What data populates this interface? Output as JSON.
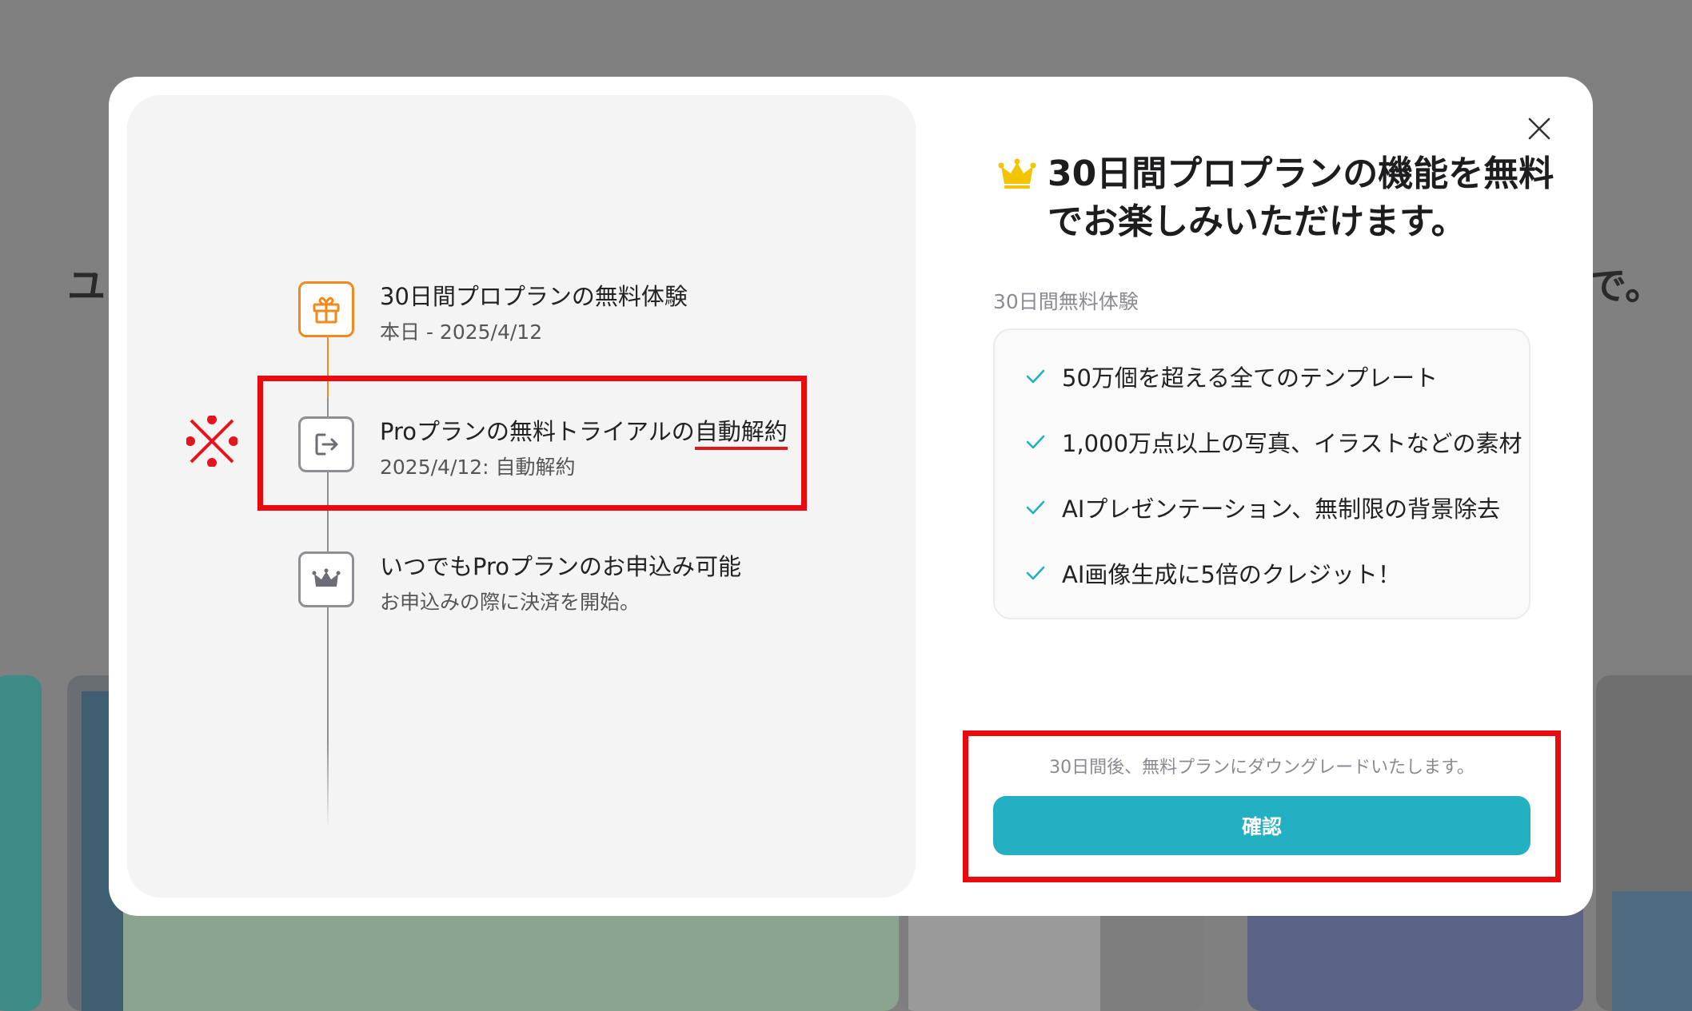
{
  "background": {
    "left_text": "ユ",
    "right_text": "で。"
  },
  "timeline": {
    "steps": [
      {
        "title": "30日間プロプランの無料体験",
        "sub": "本日 - 2025/4/12",
        "icon": "gift-icon"
      },
      {
        "title_prefix": "Proプランの無料トライアルの",
        "title_emph": "自動解約",
        "sub": "2025/4/12: 自動解約",
        "icon": "exit-icon"
      },
      {
        "title": "いつでもProプランのお申込み可能",
        "sub": "お申込みの際に決済を開始。",
        "icon": "crown-icon"
      }
    ],
    "annotation_mark": "※"
  },
  "dialog": {
    "headline": "30日間プロプランの機能を無料でお楽しみいただけます。",
    "section_label": "30日間無料体験",
    "features": [
      "50万個を超える全てのテンプレート",
      "1,000万点以上の写真、イラストなどの素材",
      "AIプレゼンテーション、無制限の背景除去",
      "AI画像生成に5倍のクレジット！"
    ],
    "note": "30日間後、無料プランにダウングレードいたします。",
    "confirm_label": "確認"
  },
  "colors": {
    "accent": "#22b0c2",
    "highlight_red": "#ea0b10",
    "gift_orange": "#f08a1c",
    "crown_gold": "#f5c400"
  }
}
